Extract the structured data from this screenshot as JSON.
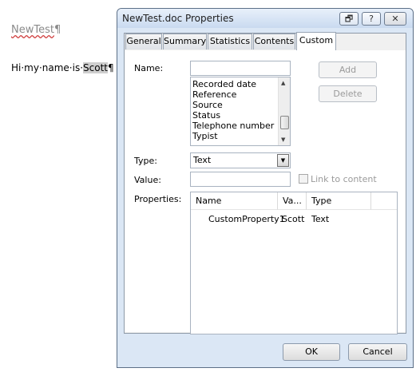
{
  "document": {
    "title_word": "NewTest",
    "pilcrow": "¶",
    "body_before": "Hi·my·name·is·",
    "body_highlight": "Scott",
    "body_after": "¶"
  },
  "dialog": {
    "title": "NewTest.doc Properties",
    "titlebar_buttons": {
      "restore": "🗗",
      "help": "?",
      "close": "✕"
    },
    "tabs": [
      {
        "label": "General"
      },
      {
        "label": "Summary"
      },
      {
        "label": "Statistics"
      },
      {
        "label": "Contents"
      },
      {
        "label": "Custom",
        "active": true
      }
    ],
    "name_label": "Name:",
    "name_value": "",
    "name_list": [
      "Recorded date",
      "Reference",
      "Source",
      "Status",
      "Telephone number",
      "Typist"
    ],
    "add_label": "Add",
    "delete_label": "Delete",
    "type_label": "Type:",
    "type_value": "Text",
    "value_label": "Value:",
    "value_value": "",
    "link_label": "Link to content",
    "link_checked": false,
    "properties_label": "Properties:",
    "properties_columns": [
      "Name",
      "Va...",
      "Type"
    ],
    "properties_rows": [
      {
        "name": "CustomProperty1",
        "value": "Scott",
        "type": "Text"
      }
    ],
    "ok_label": "OK",
    "cancel_label": "Cancel"
  },
  "colors": {
    "dialog_frame": "#dbe7f5",
    "panel": "#ffffff",
    "disabled_text": "#9a9a9a",
    "highlight": "#cfcfcf"
  }
}
